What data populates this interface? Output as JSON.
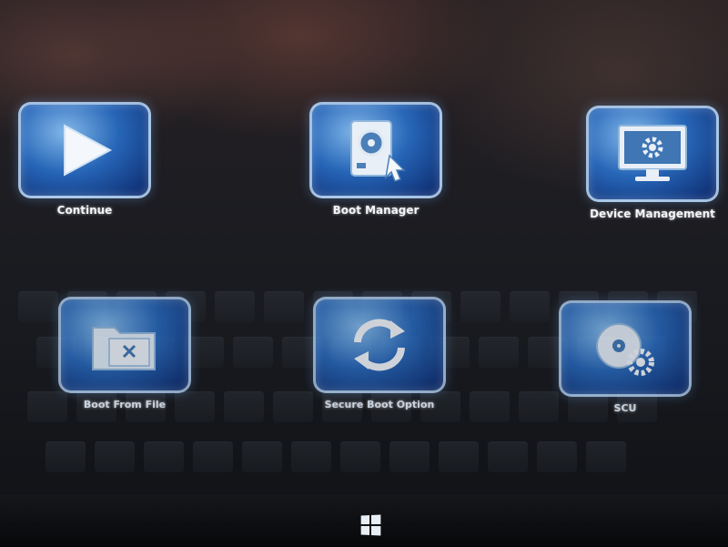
{
  "window": {
    "title": ""
  },
  "colors": {
    "tile_border": "#bed7f0",
    "tile_fill": "#2d6ec8",
    "label": "#f3f5f8"
  },
  "menu": {
    "items": [
      {
        "label": "Continue",
        "icon": "play-icon"
      },
      {
        "label": "Boot Manager",
        "icon": "boot-disk-icon"
      },
      {
        "label": "Device Management",
        "icon": "monitor-gear-icon"
      },
      {
        "label": "Boot From File",
        "icon": "folder-file-icon"
      },
      {
        "label": "Secure Boot Option",
        "icon": "refresh-arrows-icon"
      },
      {
        "label": "SCU",
        "icon": "disc-gear-icon"
      }
    ]
  },
  "taskbar": {
    "icon": "windows-logo-icon"
  }
}
